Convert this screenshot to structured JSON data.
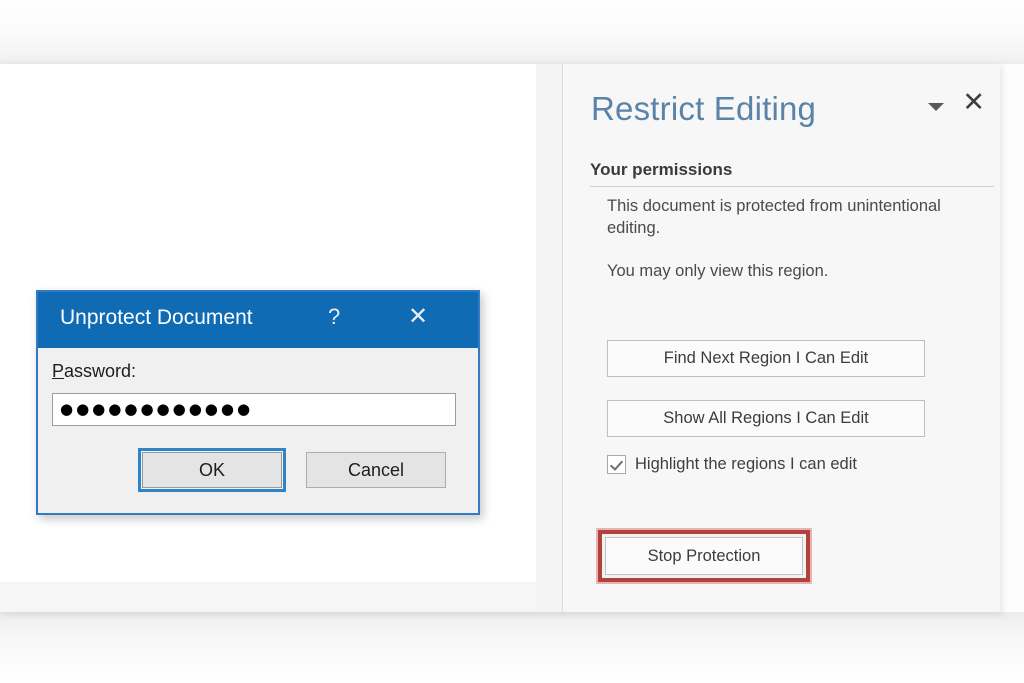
{
  "task_pane": {
    "title": "Restrict Editing",
    "chevron_icon": "chevron-down-icon",
    "close_icon": "close-icon",
    "section_heading": "Your permissions",
    "description_line_1": "This document is protected from unintentional editing.",
    "description_line_2": "You may only view this region.",
    "buttons": {
      "find_next_region": "Find Next Region I Can Edit",
      "show_all_regions": "Show All Regions I Can Edit",
      "stop_protection": "Stop Protection"
    },
    "highlight_checkbox": {
      "label": "Highlight the regions I can edit",
      "checked": true
    },
    "title_color": "#5b82a8",
    "highlight_border_color": "#b0423c"
  },
  "annotation": {
    "arrow_color": "#f4554a",
    "arrow_shadow_color": "#2e2e2e",
    "points_to": "Stop Protection"
  },
  "dialog": {
    "title": "Unprotect Document",
    "help_label": "?",
    "close_label": "✕",
    "titlebar_color": "#0e6bb4",
    "password_label_accel": "P",
    "password_label_rest": "assword:",
    "password_value": "●●●●●●●●●●●●",
    "password_placeholder": "",
    "ok_label": "OK",
    "cancel_label": "Cancel",
    "focused_button": "OK"
  }
}
